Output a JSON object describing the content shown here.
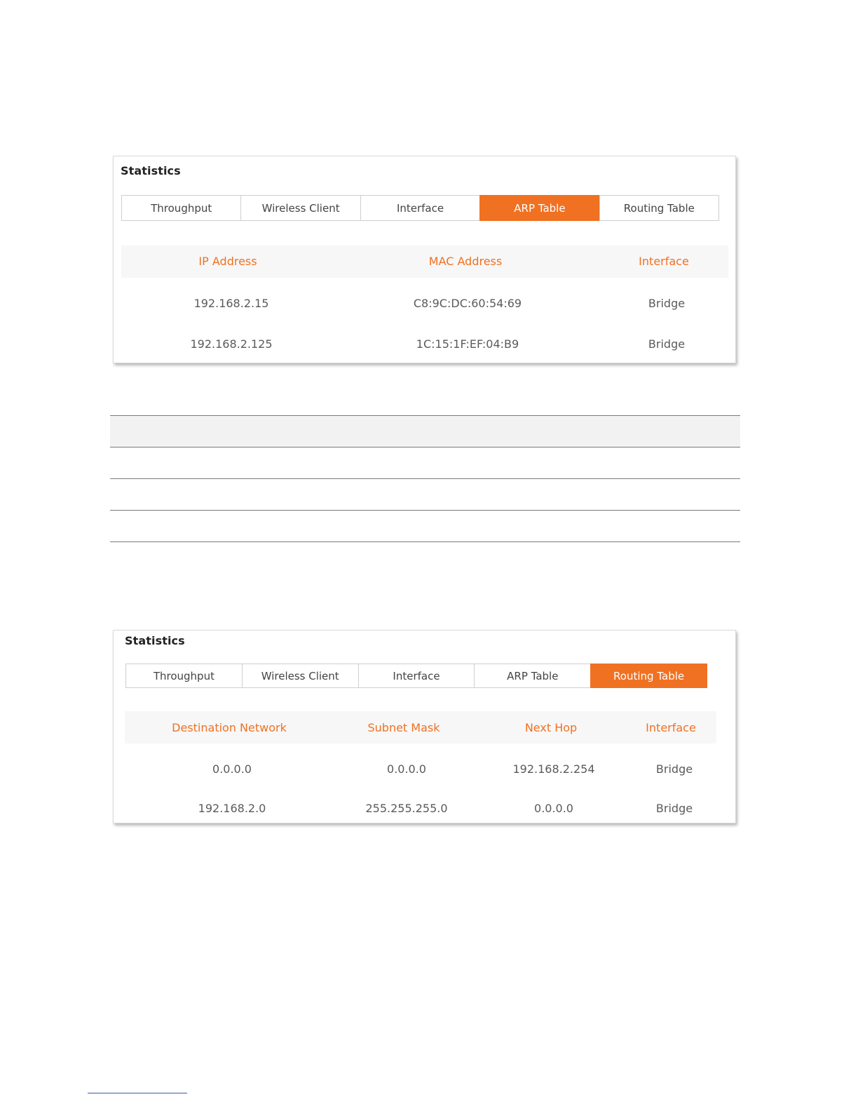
{
  "arp_panel": {
    "title": "Statistics",
    "tabs": [
      {
        "label": "Throughput",
        "active": false
      },
      {
        "label": "Wireless Client",
        "active": false
      },
      {
        "label": "Interface",
        "active": false
      },
      {
        "label": "ARP Table",
        "active": true
      },
      {
        "label": "Routing Table",
        "active": false
      }
    ],
    "headers": [
      "IP Address",
      "MAC Address",
      "Interface"
    ],
    "rows": [
      [
        "192.168.2.15",
        "C8:9C:DC:60:54:69",
        "Bridge"
      ],
      [
        "192.168.2.125",
        "1C:15:1F:EF:04:B9",
        "Bridge"
      ]
    ]
  },
  "routing_panel": {
    "title": "Statistics",
    "tabs": [
      {
        "label": "Throughput",
        "active": false
      },
      {
        "label": "Wireless Client",
        "active": false
      },
      {
        "label": "Interface",
        "active": false
      },
      {
        "label": "ARP Table",
        "active": false
      },
      {
        "label": "Routing Table",
        "active": true
      }
    ],
    "headers": [
      "Destination Network",
      "Subnet Mask",
      "Next Hop",
      "Interface"
    ],
    "rows": [
      [
        "0.0.0.0",
        "0.0.0.0",
        "192.168.2.254",
        "Bridge"
      ],
      [
        "192.168.2.0",
        "255.255.255.0",
        "0.0.0.0",
        "Bridge"
      ]
    ]
  },
  "colors": {
    "accent": "#f07122",
    "header_background": "#f7f7f7",
    "text": "#5a5a5a"
  }
}
